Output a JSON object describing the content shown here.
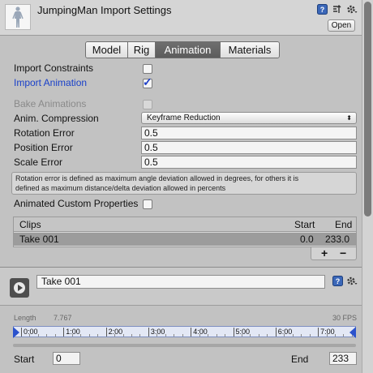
{
  "header": {
    "title": "JumpingMan Import Settings",
    "open_label": "Open",
    "icons": [
      "help-icon",
      "preset-icon",
      "gear-icon"
    ]
  },
  "tabs": [
    {
      "label": "Model",
      "active": false
    },
    {
      "label": "Rig",
      "active": false
    },
    {
      "label": "Animation",
      "active": true
    },
    {
      "label": "Materials",
      "active": false
    }
  ],
  "props": {
    "import_constraints": {
      "label": "Import Constraints",
      "checked": false
    },
    "import_animation": {
      "label": "Import Animation",
      "checked": true
    },
    "bake_animations": {
      "label": "Bake Animations",
      "checked": false,
      "disabled": true
    },
    "anim_compression": {
      "label": "Anim. Compression",
      "value": "Keyframe Reduction"
    },
    "rotation_error": {
      "label": "Rotation Error",
      "value": "0.5"
    },
    "position_error": {
      "label": "Position Error",
      "value": "0.5"
    },
    "scale_error": {
      "label": "Scale Error",
      "value": "0.5"
    },
    "help_text_line1": "Rotation error is defined as maximum angle deviation allowed in degrees, for others it is",
    "help_text_line2": "defined as maximum distance/delta deviation allowed in percents",
    "animated_custom_properties": {
      "label": "Animated Custom Properties",
      "checked": false
    }
  },
  "clips": {
    "headers": {
      "clips": "Clips",
      "start": "Start",
      "end": "End"
    },
    "rows": [
      {
        "name": "Take 001",
        "start": "0.0",
        "end": "233.0"
      }
    ],
    "add_label": "+",
    "remove_label": "−"
  },
  "clip_panel": {
    "name": "Take 001",
    "length_label": "Length",
    "length_value": "7.767",
    "fps": "30 FPS",
    "timeline_ticks": [
      "0:00",
      "1:00",
      "2:00",
      "3:00",
      "4:00",
      "5:00",
      "6:00",
      "7:00"
    ],
    "start_label": "Start",
    "start_value": "0",
    "end_label": "End",
    "end_value": "233"
  },
  "colors": {
    "accent_blue": "#1a41c9",
    "selected_row": "#9c9c9c",
    "active_tab": "#666666",
    "handle_blue": "#2b52cc"
  }
}
